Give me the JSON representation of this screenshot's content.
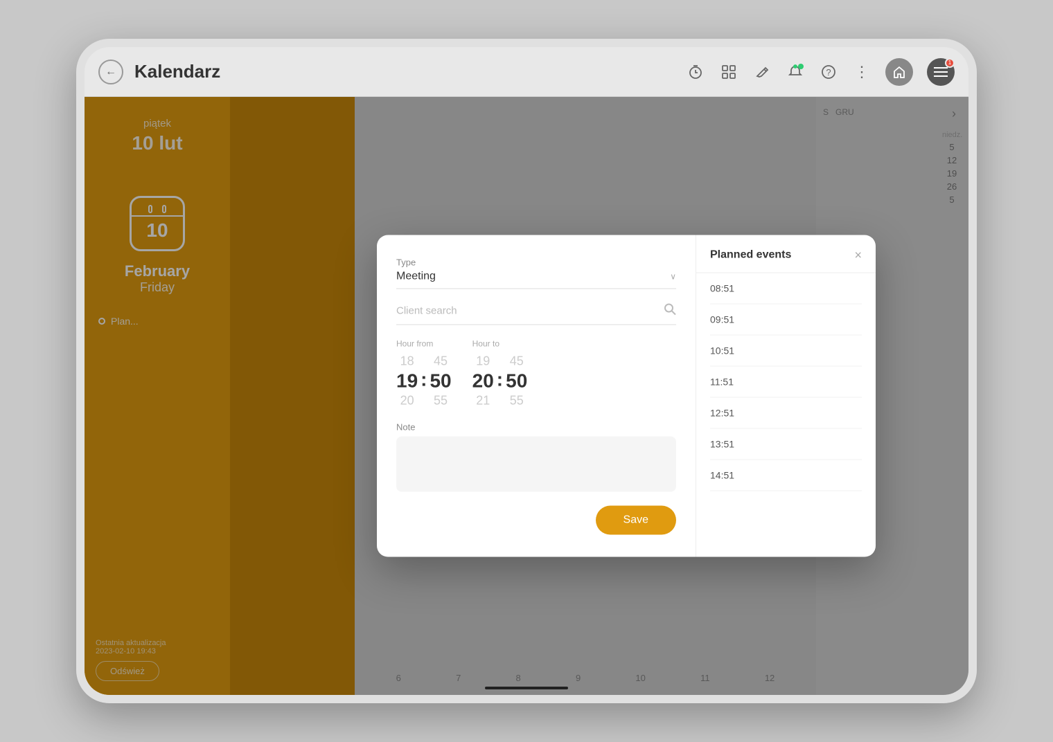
{
  "app": {
    "title": "Kalendarz"
  },
  "topbar": {
    "back_label": "←",
    "icons": {
      "timer": "⏱",
      "grid": "⊞",
      "edit": "✎",
      "notification_dot_color": "#2ecc71",
      "question": "?",
      "more": "⋮",
      "home": "⌂",
      "menu": "≡",
      "notif_count": "1"
    }
  },
  "calendar": {
    "day_name": "piątek",
    "day_short": "10 lut",
    "day_num": "10",
    "month": "February",
    "weekday": "Friday",
    "last_update_label": "Ostatnia aktualizacja",
    "last_update_value": "2023-02-10 19:43",
    "refresh_label": "Odśwież",
    "planned_label": "Plan...",
    "mini_strip": {
      "nav_prev": "‹",
      "nav_next": "›",
      "month_labels": [
        "S",
        "GRU"
      ],
      "week_header": [
        "niedz."
      ],
      "rows": [
        "5",
        "12",
        "19",
        "26",
        "5"
      ]
    }
  },
  "modal": {
    "form": {
      "type_label": "Type",
      "type_value": "Meeting",
      "client_search_placeholder": "Client search",
      "hour_from_label": "Hour from",
      "hour_to_label": "Hour to",
      "time_from": {
        "hour_prev": "18",
        "hour_current": "19",
        "hour_next": "20",
        "min_prev": "45",
        "min_current": "50",
        "min_next": "55"
      },
      "time_to": {
        "hour_prev": "19",
        "hour_current": "20",
        "hour_next": "21",
        "min_prev": "45",
        "min_current": "50",
        "min_next": "55"
      },
      "note_label": "Note",
      "note_placeholder": "",
      "save_label": "Save"
    },
    "planned_events": {
      "title": "Planned events",
      "close_btn": "×",
      "times": [
        "08:51",
        "09:51",
        "10:51",
        "11:51",
        "12:51",
        "13:51",
        "14:51"
      ]
    }
  }
}
